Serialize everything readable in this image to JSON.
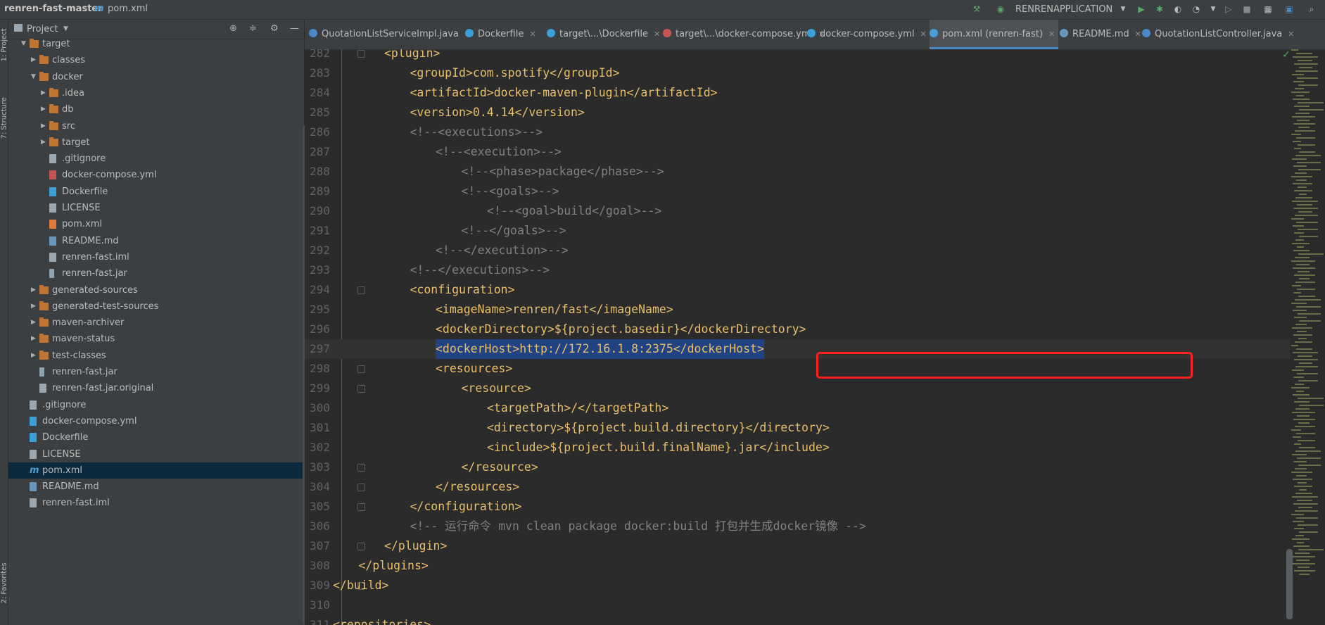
{
  "breadcrumb": {
    "project": "renren-fast-master",
    "file": "pom.xml"
  },
  "toolbar": {
    "run_config": "RENRENAPPLICATION"
  },
  "side_strip": {
    "project_label": "1: Project",
    "structure_label": "7: Structure",
    "favorites_label": "2: Favorites"
  },
  "project_panel": {
    "title": "Project",
    "items": [
      {
        "label": "target",
        "kind": "folder",
        "depth": 1,
        "arrow": "open"
      },
      {
        "label": "classes",
        "kind": "folder",
        "depth": 2,
        "arrow": "closed"
      },
      {
        "label": "docker",
        "kind": "folder",
        "depth": 2,
        "arrow": "open"
      },
      {
        "label": ".idea",
        "kind": "folder",
        "depth": 3,
        "arrow": "closed"
      },
      {
        "label": "db",
        "kind": "folder",
        "depth": 3,
        "arrow": "closed"
      },
      {
        "label": "src",
        "kind": "folder",
        "depth": 3,
        "arrow": "closed"
      },
      {
        "label": "target",
        "kind": "folder",
        "depth": 3,
        "arrow": "closed"
      },
      {
        "label": ".gitignore",
        "kind": "file",
        "depth": 3,
        "arrow": ""
      },
      {
        "label": "docker-compose.yml",
        "kind": "yml",
        "depth": 3,
        "arrow": ""
      },
      {
        "label": "Dockerfile",
        "kind": "docker",
        "depth": 3,
        "arrow": ""
      },
      {
        "label": "LICENSE",
        "kind": "file",
        "depth": 3,
        "arrow": ""
      },
      {
        "label": "pom.xml",
        "kind": "xml",
        "depth": 3,
        "arrow": ""
      },
      {
        "label": "README.md",
        "kind": "md",
        "depth": 3,
        "arrow": ""
      },
      {
        "label": "renren-fast.iml",
        "kind": "file",
        "depth": 3,
        "arrow": ""
      },
      {
        "label": "renren-fast.jar",
        "kind": "jar",
        "depth": 3,
        "arrow": ""
      },
      {
        "label": "generated-sources",
        "kind": "folder",
        "depth": 2,
        "arrow": "closed"
      },
      {
        "label": "generated-test-sources",
        "kind": "folder",
        "depth": 2,
        "arrow": "closed"
      },
      {
        "label": "maven-archiver",
        "kind": "folder",
        "depth": 2,
        "arrow": "closed"
      },
      {
        "label": "maven-status",
        "kind": "folder",
        "depth": 2,
        "arrow": "closed"
      },
      {
        "label": "test-classes",
        "kind": "folder",
        "depth": 2,
        "arrow": "closed"
      },
      {
        "label": "renren-fast.jar",
        "kind": "jar",
        "depth": 2,
        "arrow": ""
      },
      {
        "label": "renren-fast.jar.original",
        "kind": "file",
        "depth": 2,
        "arrow": ""
      },
      {
        "label": ".gitignore",
        "kind": "file",
        "depth": 1,
        "arrow": ""
      },
      {
        "label": "docker-compose.yml",
        "kind": "docker",
        "depth": 1,
        "arrow": ""
      },
      {
        "label": "Dockerfile",
        "kind": "docker",
        "depth": 1,
        "arrow": ""
      },
      {
        "label": "LICENSE",
        "kind": "file",
        "depth": 1,
        "arrow": ""
      },
      {
        "label": "pom.xml",
        "kind": "maven",
        "depth": 1,
        "arrow": "",
        "selected": true
      },
      {
        "label": "README.md",
        "kind": "md",
        "depth": 1,
        "arrow": ""
      },
      {
        "label": "renren-fast.iml",
        "kind": "file",
        "depth": 1,
        "arrow": ""
      }
    ]
  },
  "tabs": [
    {
      "label": "QuotationListServiceImpl.java",
      "icon_color": "#4a88c7"
    },
    {
      "label": "Dockerfile",
      "icon_color": "#3d9fd8"
    },
    {
      "label": "target\\...\\Dockerfile",
      "icon_color": "#3d9fd8"
    },
    {
      "label": "target\\...\\docker-compose.yml",
      "icon_color": "#c75450"
    },
    {
      "label": "docker-compose.yml",
      "icon_color": "#3d9fd8"
    },
    {
      "label": "pom.xml (renren-fast)",
      "icon_color": "#4a9fd8",
      "active": true
    },
    {
      "label": "README.md",
      "icon_color": "#6897bb"
    },
    {
      "label": "QuotationListController.java",
      "icon_color": "#4a88c7"
    }
  ],
  "code_lines": [
    {
      "no": "282",
      "indent": 2,
      "text": "<plugin>",
      "type": "tag",
      "fold": true
    },
    {
      "no": "283",
      "indent": 3,
      "text": "<groupId>com.spotify</groupId>",
      "type": "tag"
    },
    {
      "no": "284",
      "indent": 3,
      "text": "<artifactId>docker-maven-plugin</artifactId>",
      "type": "tag"
    },
    {
      "no": "285",
      "indent": 3,
      "text": "<version>0.4.14</version>",
      "type": "tag"
    },
    {
      "no": "286",
      "indent": 3,
      "text": "<!--<executions>-->",
      "type": "comment"
    },
    {
      "no": "287",
      "indent": 4,
      "text": "<!--<execution>-->",
      "type": "comment"
    },
    {
      "no": "288",
      "indent": 5,
      "text": "<!--<phase>package</phase>-->",
      "type": "comment"
    },
    {
      "no": "289",
      "indent": 5,
      "text": "<!--<goals>-->",
      "type": "comment"
    },
    {
      "no": "290",
      "indent": 6,
      "text": "<!--<goal>build</goal>-->",
      "type": "comment"
    },
    {
      "no": "291",
      "indent": 5,
      "text": "<!--</goals>-->",
      "type": "comment"
    },
    {
      "no": "292",
      "indent": 4,
      "text": "<!--</execution>-->",
      "type": "comment"
    },
    {
      "no": "293",
      "indent": 3,
      "text": "<!--</executions>-->",
      "type": "comment"
    },
    {
      "no": "294",
      "indent": 3,
      "text": "<configuration>",
      "type": "tag",
      "fold": true
    },
    {
      "no": "295",
      "indent": 4,
      "text": "<imageName>renren/fast</imageName>",
      "type": "tag"
    },
    {
      "no": "296",
      "indent": 4,
      "text": "<dockerDirectory>${project.basedir}</dockerDirectory>",
      "type": "tag"
    },
    {
      "no": "297",
      "indent": 4,
      "text": "<dockerHost>http://172.16.1.8:2375</dockerHost>",
      "type": "tag",
      "selected": true
    },
    {
      "no": "298",
      "indent": 4,
      "text": "<resources>",
      "type": "tag",
      "fold": true
    },
    {
      "no": "299",
      "indent": 5,
      "text": "<resource>",
      "type": "tag",
      "fold": true
    },
    {
      "no": "300",
      "indent": 6,
      "text": "<targetPath>/</targetPath>",
      "type": "tag"
    },
    {
      "no": "301",
      "indent": 6,
      "text": "<directory>${project.build.directory}</directory>",
      "type": "tag"
    },
    {
      "no": "302",
      "indent": 6,
      "text": "<include>${project.build.finalName}.jar</include>",
      "type": "tag"
    },
    {
      "no": "303",
      "indent": 5,
      "text": "</resource>",
      "type": "tag",
      "fold": true
    },
    {
      "no": "304",
      "indent": 4,
      "text": "</resources>",
      "type": "tag",
      "fold": true
    },
    {
      "no": "305",
      "indent": 3,
      "text": "</configuration>",
      "type": "tag",
      "fold": true
    },
    {
      "no": "306",
      "indent": 3,
      "text": "<!-- 运行命令 mvn clean package docker:build 打包并生成docker镜像 -->",
      "type": "comment"
    },
    {
      "no": "307",
      "indent": 2,
      "text": "</plugin>",
      "type": "tag",
      "fold": true
    },
    {
      "no": "308",
      "indent": 1,
      "text": "</plugins>",
      "type": "tag"
    },
    {
      "no": "309",
      "indent": 0,
      "text": "</build>",
      "type": "tag",
      "fold": true
    },
    {
      "no": "310",
      "indent": 0,
      "text": "",
      "type": "tag"
    },
    {
      "no": "311",
      "indent": 0,
      "text": "<repositories>",
      "type": "tag"
    }
  ]
}
